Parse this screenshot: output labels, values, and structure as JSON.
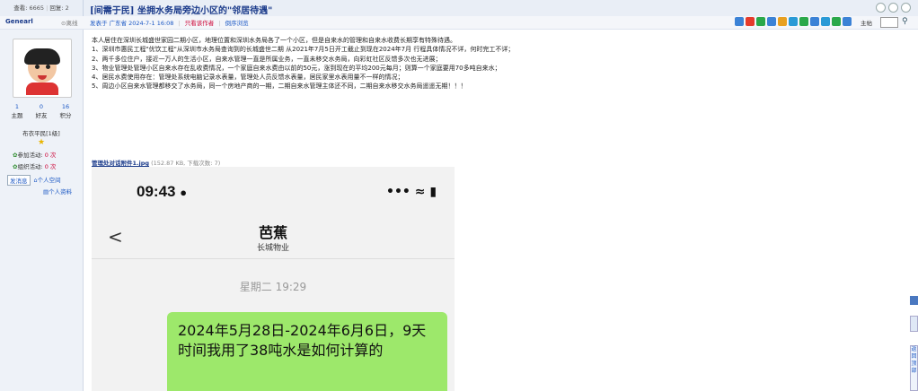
{
  "thread": {
    "views_label": "查看:",
    "views": "6665",
    "replies_label": "回复:",
    "replies": "2",
    "title": "[间需于民] 坐拥水务局旁边小区的\"邻居待遇\""
  },
  "post_meta": {
    "posted_by": "发表于 广东省 2024-7-1 16:08",
    "only_author": "只看该作者",
    "reverse": "倒序浏览"
  },
  "toolbar": {
    "author_only_label": "主帖",
    "icons": [
      "share-icon",
      "weibo-icon",
      "wechat-icon",
      "print-icon",
      "qzone-icon",
      "tencent-icon",
      "douban-icon",
      "renren-icon",
      "email-icon",
      "favorite-icon",
      "report-icon"
    ],
    "icon_colors": [
      "#3b82d6",
      "#e53b2c",
      "#2aa84a",
      "#3b82d6",
      "#e8a020",
      "#2a9ad6",
      "#2aa84a",
      "#3b82d6",
      "#2a9ad6",
      "#2aa84a",
      "#3b82d6"
    ]
  },
  "user": {
    "name": "Genearl",
    "status": "离线",
    "counts": [
      {
        "value": "1",
        "label": "主题"
      },
      {
        "value": "0",
        "label": "好友"
      },
      {
        "value": "16",
        "label": "积分"
      }
    ],
    "rank": "布衣平民[1级]",
    "activity1_label": "参加活动:",
    "activity1_count": "0 次",
    "activity2_label": "组织活动:",
    "activity2_count": "0 次",
    "send_message": "发消息",
    "space": "个人空间",
    "profile": "个人资料"
  },
  "post": {
    "lines": [
      "本人居住在深圳长城盛世家园二期小区，地理位置和深圳水务局各了一个小区，但是自来水的管理和自来水收费长期享有特殊待遇。",
      "1、深圳市惠民工程\"优饮工程\"从深圳市水务局查询到的长城盛世二期 从2021年7月5日开工截止到现在2024年7月 行程具体情况不详，何时完工不详；",
      "2、两千多位住户，接近一万人的生活小区，自来水管理一直是所属业务，一直未移交水务局，向彩虹社区反馈多次也无进展；",
      "3、物业管理处管理小区自来水存在乱收费情况，一个家庭自来水费由以前的50元，涨到现在的平均200元每月；则算一个家庭要用70多吨自来水；",
      "4、居民水费使用存在：管理处系统电脑记录水表量，管理处人员反馈水表量，居民家里水表用量不一样的情况；",
      "5、周边小区自来水管理都移交了水务局，同一个房地产商的一期，二期自来水管理主体还不同，二期自来水移交水务局遥遥无期！！！"
    ]
  },
  "attachment": {
    "name": "管理处对话附件1.jpg",
    "info": "(152.87 KB, 下载次数: 7)"
  },
  "screenshot": {
    "time": "09:43",
    "status_icons": "••• ≈ ▮",
    "back": "<",
    "contact_name": "芭蕉",
    "contact_org": "长城物业",
    "date": "星期二 19:29",
    "message": "2024年5月28日-2024年6月6日，9天时间我用了38吨水是如何计算的"
  },
  "side_widget": {
    "back_top": "返回顶部"
  }
}
